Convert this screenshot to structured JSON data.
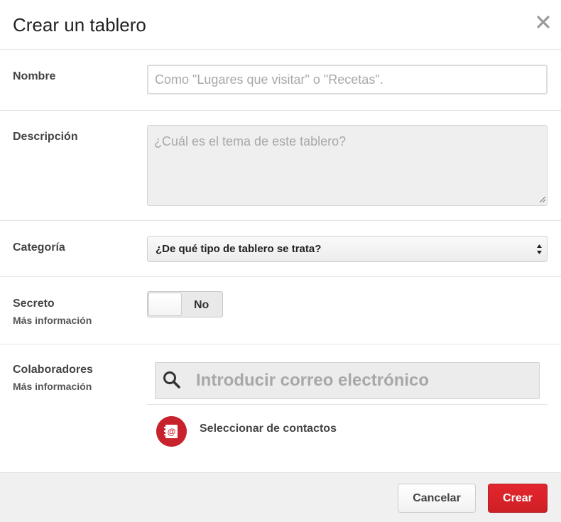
{
  "dialog": {
    "title": "Crear un tablero"
  },
  "fields": {
    "name": {
      "label": "Nombre",
      "placeholder": "Como \"Lugares que visitar\" o \"Recetas\".",
      "value": ""
    },
    "description": {
      "label": "Descripción",
      "placeholder": "¿Cuál es el tema de este tablero?",
      "value": ""
    },
    "category": {
      "label": "Categoría",
      "selected": "¿De qué tipo de tablero se trata?"
    },
    "secret": {
      "label": "Secreto",
      "more_info": "Más información",
      "toggle_text": "No",
      "enabled": false
    },
    "collaborators": {
      "label": "Colaboradores",
      "more_info": "Más información",
      "email_placeholder": "Introducir correo electrónico",
      "contacts_label": "Seleccionar de contactos"
    }
  },
  "footer": {
    "cancel_label": "Cancelar",
    "create_label": "Crear"
  },
  "colors": {
    "accent": "#cf1f26",
    "footer_bg": "#f0f0f0",
    "field_bg": "#efefef"
  },
  "icons": {
    "close": "close-icon",
    "select": "select-arrows-icon",
    "search": "search-icon",
    "contacts": "contacts-book-icon"
  }
}
